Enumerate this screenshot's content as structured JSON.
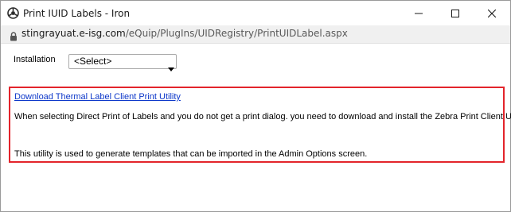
{
  "window": {
    "title": "Print IUID Labels - Iron",
    "controls": {
      "minimize_icon": "minimize-icon",
      "maximize_icon": "maximize-icon",
      "close_icon": "close-icon"
    }
  },
  "address_bar": {
    "host": "stingrayuat.e-isg.com",
    "path": "/eQuip/PlugIns/UIDRegistry/PrintUIDLabel.aspx",
    "lock_icon": "lock-icon"
  },
  "form": {
    "installation_label": "Installation",
    "installation_select_value": "<Select>"
  },
  "info": {
    "download_link": "Download Thermal Label Client Print Utility",
    "text_1": "When selecting Direct Print of Labels and you do not get a print dialog. you need to download and install the Zebra Print Client Utility.",
    "text_2": "This utility is used to generate templates that can be imported in the Admin Options screen."
  },
  "colors": {
    "highlight_border": "#e3242b",
    "link": "#0b36c9",
    "address_bar_bg": "#f0f0f0"
  }
}
